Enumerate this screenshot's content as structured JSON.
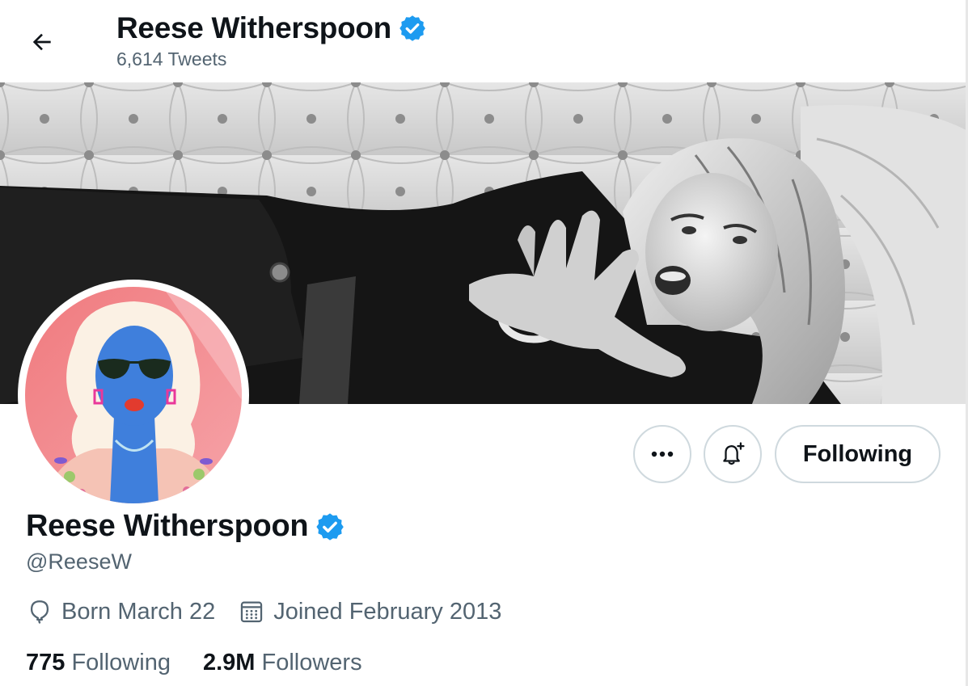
{
  "header": {
    "name": "Reese Witherspoon",
    "tweets_count": "6,614 Tweets"
  },
  "profile": {
    "name": "Reese Witherspoon",
    "handle": "@ReeseW",
    "birthday": "Born March 22",
    "joined": "Joined February 2013",
    "following_count": "775",
    "following_label": "Following",
    "followers_count": "2.9M",
    "followers_label": "Followers"
  },
  "actions": {
    "following_button": "Following"
  },
  "icons": {
    "back": "arrow-left-icon",
    "verified": "verified-badge-icon",
    "more": "more-dots-icon",
    "notify": "bell-plus-icon",
    "birthday": "balloon-icon",
    "calendar": "calendar-icon"
  },
  "colors": {
    "verified_blue": "#1d9bf0",
    "text_primary": "#0f1419",
    "text_secondary": "#536471",
    "border": "#cfd9de"
  }
}
